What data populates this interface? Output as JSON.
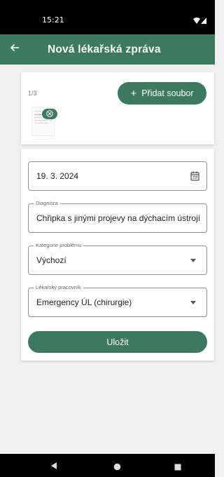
{
  "status_bar": {
    "time": "15:21",
    "icons": [
      "wifi-icon",
      "signal-icon"
    ]
  },
  "app_bar": {
    "back_icon": "arrow-back-icon",
    "title": "Nová lékařská zpráva"
  },
  "attachments": {
    "count": "1/3",
    "add_button_icon": "plus-icon",
    "add_button_label": "Přidat soubor",
    "remove_icon": "close-icon"
  },
  "form": {
    "date": {
      "value": "19. 3. 2024",
      "icon": "calendar-icon"
    },
    "diagnosis": {
      "label": "Diagnóza",
      "value": "Chřipka s jinými projevy na dýchacím ústrojí"
    },
    "category": {
      "label": "Kategorie problému",
      "value": "Výchozí",
      "icon": "dropdown-arrow-icon"
    },
    "doctor": {
      "label": "Lékařský pracovník",
      "value": "Emergency ÚL (chirurgie)",
      "icon": "dropdown-arrow-icon"
    },
    "save_label": "Uložit"
  },
  "nav_bar": {
    "icons": [
      "back-triangle-icon",
      "home-circle-icon",
      "recents-square-icon"
    ]
  },
  "colors": {
    "primary": "#3b7a5c",
    "background": "#f0f0f0"
  }
}
